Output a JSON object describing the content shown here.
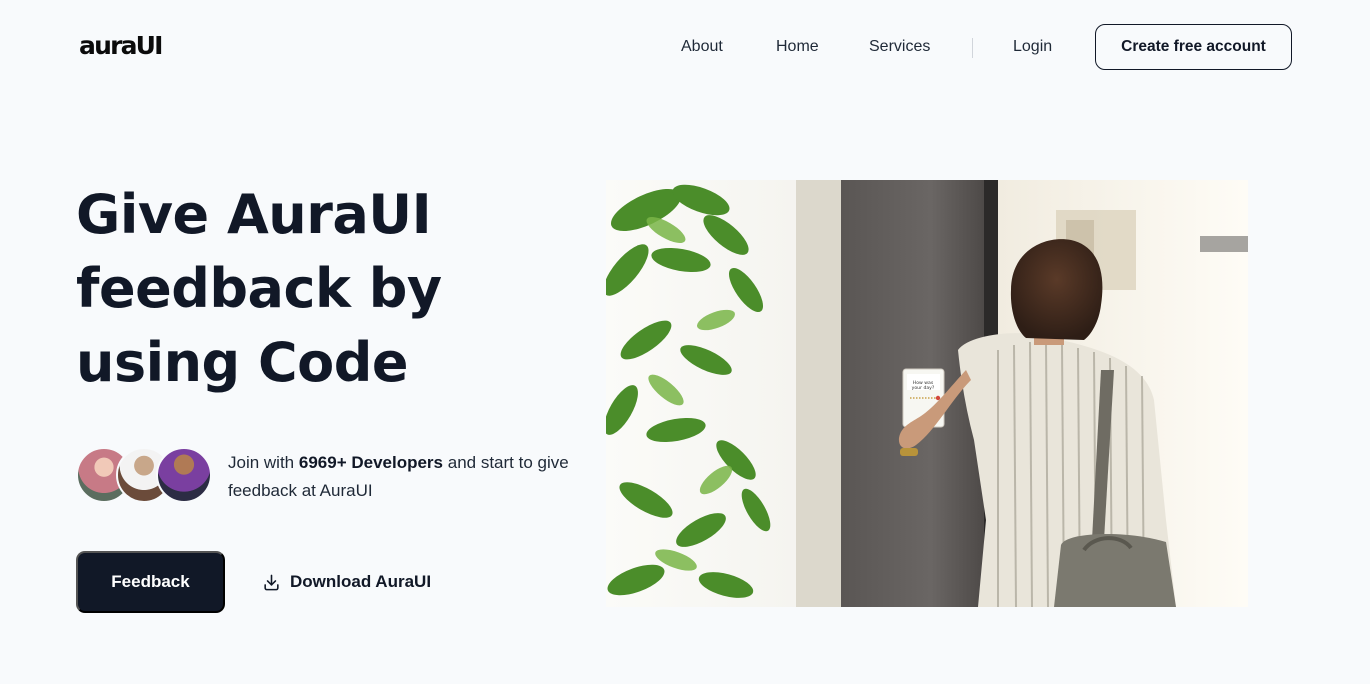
{
  "header": {
    "logo": "auraUI",
    "nav": {
      "about": "About",
      "home": "Home",
      "services": "Services",
      "login": "Login"
    },
    "cta_label": "Create free account"
  },
  "hero": {
    "title_lines": [
      "Give AuraUI",
      "feedback by",
      "using Code"
    ],
    "join": {
      "prefix": "Join with ",
      "highlight": "6969+ Developers",
      "suffix": " and start to give feedback at AuraUI"
    },
    "buttons": {
      "primary": "Feedback",
      "secondary": "Download AuraUI",
      "secondary_icon": "download-icon"
    },
    "device_text": "How was your day?"
  },
  "colors": {
    "background": "#f8fafc",
    "text_primary": "#111827",
    "button_dark": "#111827"
  }
}
